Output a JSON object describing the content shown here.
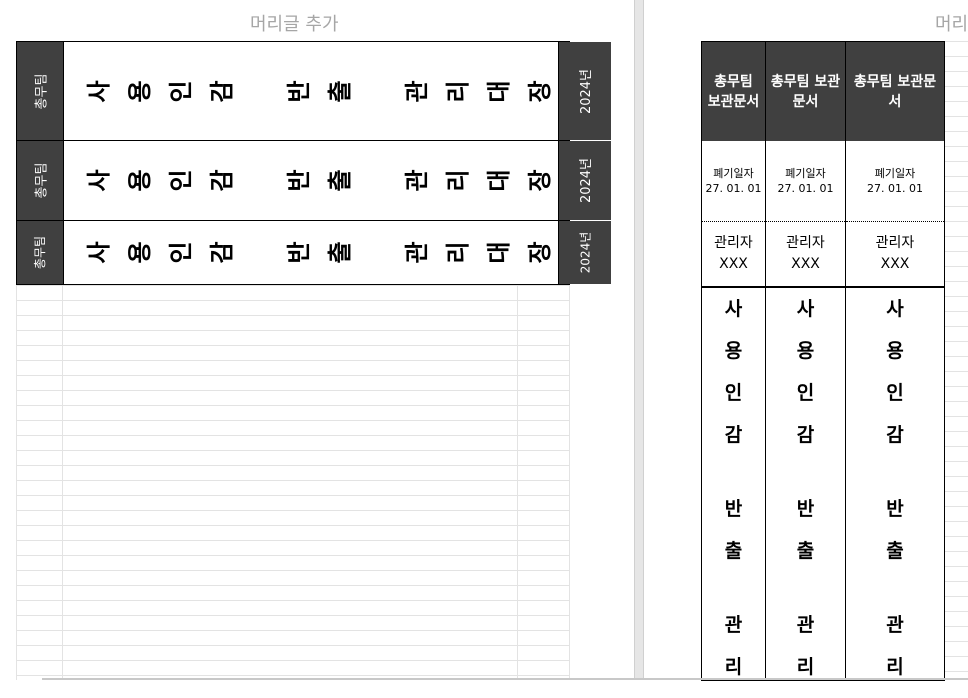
{
  "header": {
    "left_label": "머리글 추가",
    "right_label": "머리"
  },
  "labels": [
    {
      "team": "총무팀",
      "title_chars": [
        "사",
        "용",
        "인",
        "감",
        "",
        "반",
        "출",
        "",
        "관",
        "리",
        "대",
        "장"
      ],
      "year": "2024년"
    },
    {
      "team": "총무팀",
      "title_chars": [
        "사",
        "용",
        "인",
        "감",
        "",
        "반",
        "출",
        "",
        "관",
        "리",
        "대",
        "장"
      ],
      "year": "2024년"
    },
    {
      "team": "총무팀",
      "title_chars": [
        "사",
        "용",
        "인",
        "감",
        "",
        "반",
        "출",
        "",
        "관",
        "리",
        "대",
        "장"
      ],
      "year": "2024년"
    }
  ],
  "spines": [
    {
      "head": "총무팀 보관문서",
      "date_label": "폐기일자",
      "date": "27. 01. 01",
      "manager_label": "관리자",
      "manager": "XXX",
      "title_chars": [
        "사",
        "용",
        "인",
        "감",
        "",
        "반",
        "출",
        "",
        "관",
        "리"
      ]
    },
    {
      "head": "총무팀 보관문서",
      "date_label": "폐기일자",
      "date": "27. 01. 01",
      "manager_label": "관리자",
      "manager": "XXX",
      "title_chars": [
        "사",
        "용",
        "인",
        "감",
        "",
        "반",
        "출",
        "",
        "관",
        "리"
      ]
    },
    {
      "head": "총무팀 보관문서",
      "date_label": "폐기일자",
      "date": "27. 01. 01",
      "manager_label": "관리자",
      "manager": "XXX",
      "title_chars": [
        "사",
        "용",
        "인",
        "감",
        "",
        "반",
        "출",
        "",
        "관",
        "리"
      ]
    }
  ]
}
